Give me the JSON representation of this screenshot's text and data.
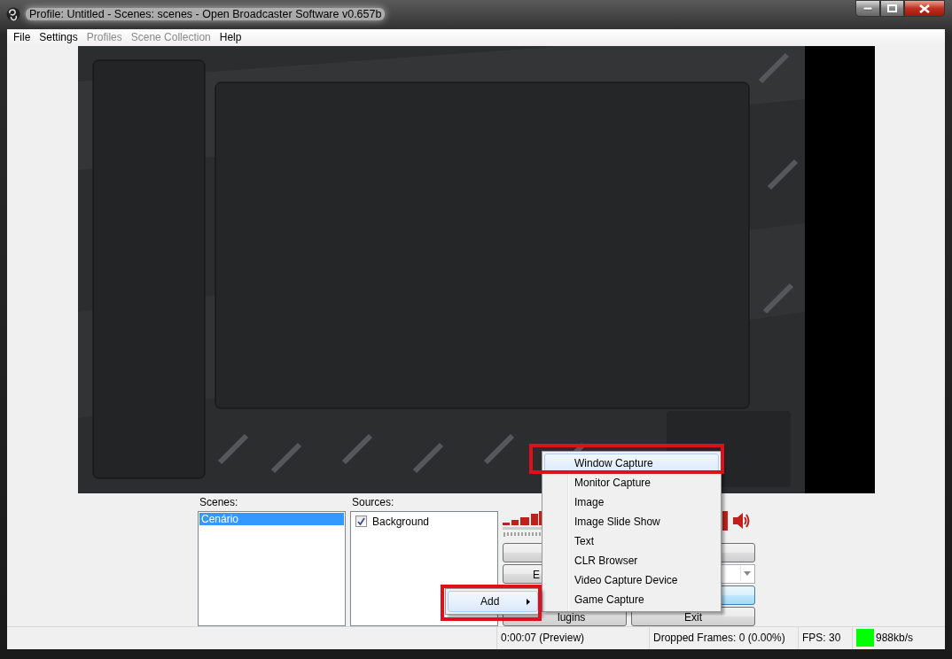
{
  "window": {
    "title": "Profile: Untitled - Scenes: scenes - Open Broadcaster Software v0.657b"
  },
  "menu": [
    {
      "label": "File",
      "disabled": false
    },
    {
      "label": "Settings",
      "disabled": false
    },
    {
      "label": "Profiles",
      "disabled": true
    },
    {
      "label": "Scene Collection",
      "disabled": true
    },
    {
      "label": "Help",
      "disabled": false
    }
  ],
  "scenes": {
    "label": "Scenes:",
    "items": [
      {
        "label": "Cenário",
        "selected": true
      }
    ]
  },
  "sources": {
    "label": "Sources:",
    "items": [
      {
        "label": "Background",
        "checked": true
      }
    ]
  },
  "buttons": [
    {
      "kind": "button"
    },
    {
      "kind": "button"
    },
    {
      "kind": "button",
      "label": "E"
    },
    {
      "kind": "dropdown"
    },
    {
      "kind": "focused"
    },
    {
      "kind": "button",
      "label": "lugins"
    },
    {
      "kind": "button",
      "label": "Exit"
    }
  ],
  "context_menu": {
    "items": [
      {
        "label": "Window Capture",
        "selected": true,
        "annotated": true
      },
      {
        "label": "Monitor Capture",
        "selected": false,
        "annotated": false
      },
      {
        "label": "Image",
        "selected": false,
        "annotated": false
      },
      {
        "label": "Image Slide Show",
        "selected": false,
        "annotated": false
      },
      {
        "label": "Text",
        "selected": false,
        "annotated": false
      },
      {
        "label": "CLR Browser",
        "selected": false,
        "annotated": false
      },
      {
        "label": "Video Capture Device",
        "selected": false,
        "annotated": false
      },
      {
        "label": "Game Capture",
        "selected": false,
        "annotated": false
      }
    ]
  },
  "add_menu": {
    "label": "Add",
    "selected": true,
    "annotated": true
  },
  "status_bar": {
    "time": "0:00:07 (Preview)",
    "dropped": "Dropped Frames: 0 (0.00%)",
    "fps": "FPS: 30",
    "bitrate": "988kb/s",
    "color": "#00ff00"
  }
}
